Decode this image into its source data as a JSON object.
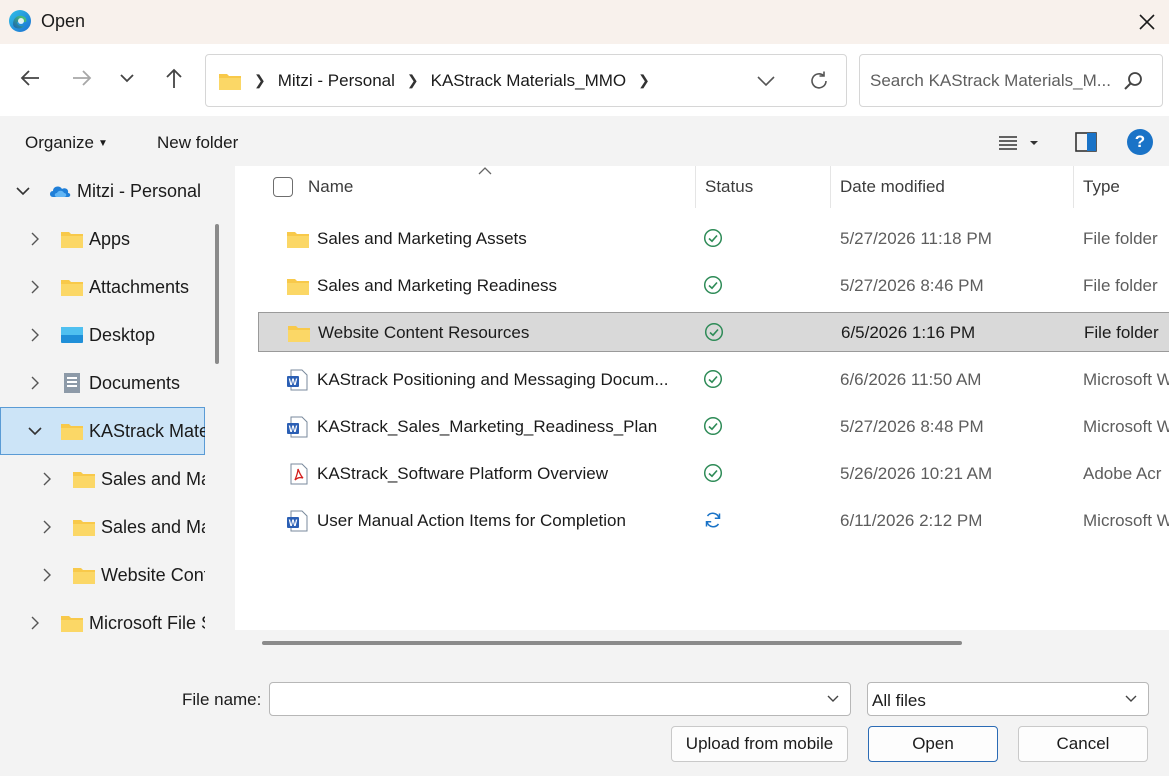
{
  "window": {
    "title": "Open",
    "app_icon": "edge-browser-icon",
    "close_icon": "close-icon"
  },
  "nav": {
    "back_icon": "arrow-left-icon",
    "forward_icon": "arrow-right-icon",
    "recent_icon": "chevron-down-icon",
    "up_icon": "arrow-up-icon",
    "breadcrumb": [
      "Mitzi - Personal",
      "KAStrack Materials_MMO"
    ],
    "search_placeholder": "Search KAStrack Materials_M..."
  },
  "toolbar": {
    "organize": "Organize",
    "new_folder": "New folder",
    "help": "?"
  },
  "sidebar": {
    "items": [
      {
        "label": "Mitzi - Personal",
        "icon": "onedrive-cloud-icon",
        "expanded": true,
        "selected": false
      },
      {
        "label": "Apps",
        "icon": "folder-icon",
        "expanded": false,
        "selected": false
      },
      {
        "label": "Attachments",
        "icon": "folder-icon",
        "expanded": false,
        "selected": false
      },
      {
        "label": "Desktop",
        "icon": "desktop-icon",
        "expanded": false,
        "selected": false
      },
      {
        "label": "Documents",
        "icon": "documents-icon",
        "expanded": false,
        "selected": false
      },
      {
        "label": "KAStrack Materials_MMO",
        "icon": "folder-icon",
        "expanded": true,
        "selected": true
      },
      {
        "label": "Sales and Marketing Assets",
        "icon": "folder-icon",
        "expanded": false,
        "selected": false
      },
      {
        "label": "Sales and Marketing Readiness",
        "icon": "folder-icon",
        "expanded": false,
        "selected": false
      },
      {
        "label": "Website Content Resources",
        "icon": "folder-icon",
        "expanded": false,
        "selected": false
      },
      {
        "label": "Microsoft File Share",
        "icon": "folder-icon",
        "expanded": false,
        "selected": false
      }
    ]
  },
  "columns": {
    "name": "Name",
    "status": "Status",
    "date": "Date modified",
    "type": "Type"
  },
  "files": [
    {
      "name": "Sales and Marketing Assets",
      "icon": "folder-icon",
      "status": "synced-check-icon",
      "date": "5/27/2026 11:18 PM",
      "type": "File folder",
      "selected": false
    },
    {
      "name": "Sales and Marketing Readiness",
      "icon": "folder-icon",
      "status": "synced-check-icon",
      "date": "5/27/2026 8:46 PM",
      "type": "File folder",
      "selected": false
    },
    {
      "name": "Website Content Resources",
      "icon": "folder-icon",
      "status": "synced-check-icon",
      "date": "6/5/2026 1:16 PM",
      "type": "File folder",
      "selected": true
    },
    {
      "name": "KAStrack Positioning and Messaging Docum...",
      "icon": "word-doc-icon",
      "status": "synced-check-icon",
      "date": "6/6/2026 11:50 AM",
      "type": "Microsoft W",
      "selected": false
    },
    {
      "name": "KAStrack_Sales_Marketing_Readiness_Plan",
      "icon": "word-doc-icon",
      "status": "synced-check-icon",
      "date": "5/27/2026 8:48 PM",
      "type": "Microsoft W",
      "selected": false
    },
    {
      "name": "KAStrack_Software Platform Overview",
      "icon": "pdf-doc-icon",
      "status": "synced-check-icon",
      "date": "5/26/2026 10:21 AM",
      "type": "Adobe Acr",
      "selected": false
    },
    {
      "name": "User Manual Action Items for Completion",
      "icon": "word-doc-icon",
      "status": "syncing-icon",
      "date": "6/11/2026 2:12 PM",
      "type": "Microsoft W",
      "selected": false
    }
  ],
  "footer": {
    "file_name_label": "File name:",
    "file_name_value": "",
    "filter_value": "All files",
    "upload_button": "Upload from mobile",
    "open_button": "Open",
    "cancel_button": "Cancel"
  },
  "colors": {
    "accent": "#1a73c7",
    "folder": "#f8c94a",
    "check": "#2e8b57",
    "selected_nav": "#cce4f7"
  }
}
